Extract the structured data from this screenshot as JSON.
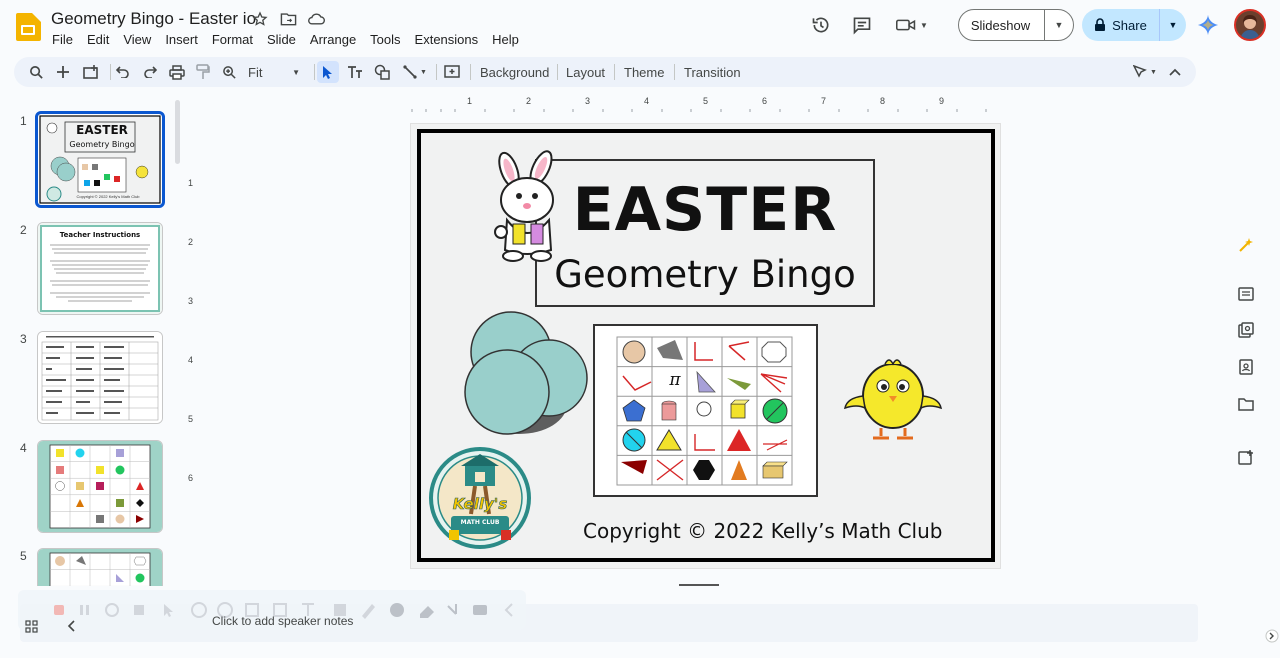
{
  "doc": {
    "title": "Geometry Bingo - Easter io",
    "star_icon": "star-icon",
    "move_icon": "folder-move-icon",
    "cloud_icon": "cloud-status-icon"
  },
  "menu": [
    "File",
    "Edit",
    "View",
    "Insert",
    "Format",
    "Slide",
    "Arrange",
    "Tools",
    "Extensions",
    "Help"
  ],
  "header_right": {
    "slideshow_label": "Slideshow",
    "share_label": "Share"
  },
  "toolbar": {
    "zoom_value": "Fit",
    "background_label": "Background",
    "layout_label": "Layout",
    "theme_label": "Theme",
    "transition_label": "Transition"
  },
  "filmstrip": {
    "slides": [
      {
        "number": "1",
        "title": "EASTER",
        "subtitle": "Geometry Bingo",
        "footer": "Copyright © 2022 Kelly's Math Club"
      },
      {
        "number": "2",
        "title": "Teacher Instructions"
      },
      {
        "number": "3"
      },
      {
        "number": "4"
      },
      {
        "number": "5"
      }
    ]
  },
  "rulers": {
    "horizontal": [
      "1",
      "2",
      "3",
      "4",
      "5",
      "6",
      "7",
      "8",
      "9"
    ],
    "vertical": [
      "1",
      "2",
      "3",
      "4",
      "5",
      "6"
    ]
  },
  "slide": {
    "title": "EASTER",
    "subtitle": "Geometry Bingo",
    "logo_line1": "Kelly's",
    "logo_line2": "MATH CLUB",
    "copyright": "Copyright © 2022 Kelly’s Math Club",
    "pi_symbol": "π"
  },
  "notes": {
    "placeholder": "Click to add speaker notes"
  },
  "colors": {
    "accent": "#0b57d0",
    "share_bg": "#c2e7ff",
    "toolbar_bg": "#edf2fa",
    "app_yellow": "#f4b400"
  }
}
